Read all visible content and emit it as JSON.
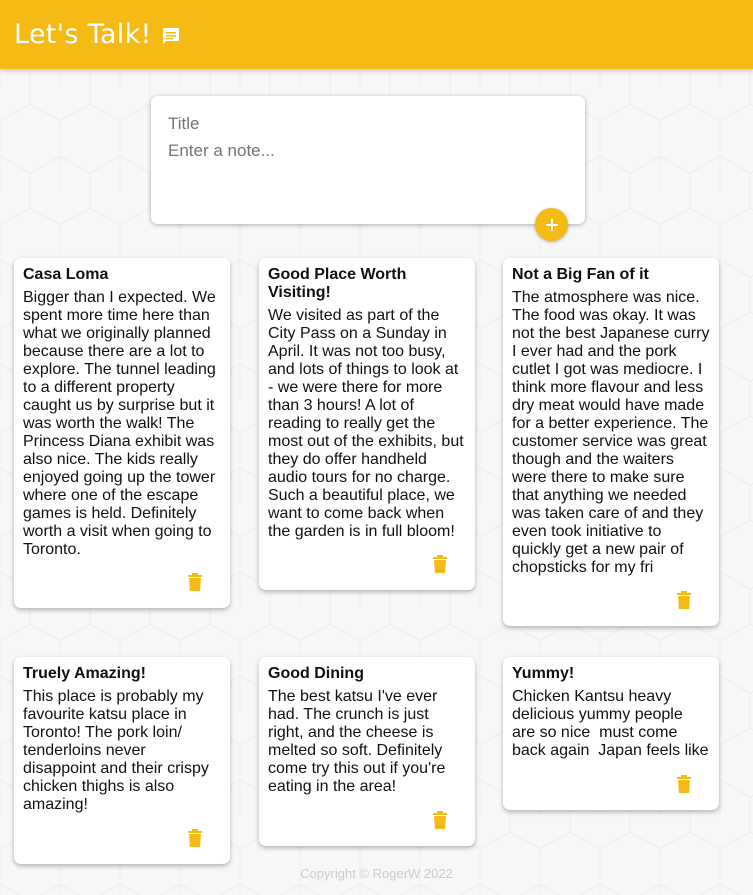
{
  "header": {
    "title": "Let's Talk!"
  },
  "create": {
    "title_placeholder": "Title",
    "content_placeholder": "Enter a note...",
    "add_label": "+"
  },
  "notes": [
    {
      "title": "Casa Loma",
      "content": "Bigger than I expected. We spent more time here than what we originally planned because there are a lot to explore. The tunnel leading to a different property caught us by surprise but it was worth the walk! The Princess Diana exhibit was also nice. The kids really enjoyed going up the tower where one of the escape games is held. Definitely worth a visit when going to Toronto."
    },
    {
      "title": "Good Place Worth Visiting!",
      "content": "We visited as part of the City Pass on a Sunday in April. It was not too busy, and lots of things to look at - we were there for more than 3 hours! A lot of reading to really get the most out of the exhibits, but they do offer handheld audio tours for no charge. Such a beautiful place, we want to come back when the garden is in full bloom!"
    },
    {
      "title": "Not a Big Fan of it",
      "content": "The atmosphere was nice. The food was okay. It was not the best Japanese curry I ever had and the pork cutlet I got was mediocre. I think more flavour and less dry meat would have made for a better experience. The customer service was great though and the waiters were there to make sure that anything we needed was taken care of and they even took initiative to quickly get a new pair of chopsticks for my fri"
    },
    {
      "title": "Truely Amazing!",
      "content": "This place is probably my favourite katsu place in Toronto! The pork loin/ tenderloins never disappoint and their crispy chicken thighs is also amazing!"
    },
    {
      "title": "Good Dining",
      "content": "The best katsu I've ever had. The crunch is just right, and the cheese is melted so soft. Definitely come try this out if you're eating in the area!"
    },
    {
      "title": "Yummy!",
      "content": "Chicken Kantsu heavy delicious yummy people are so nice  must come back again  Japan feels like"
    }
  ],
  "footer": {
    "copyright": "Copyright © RogerW 2022"
  },
  "colors": {
    "accent": "#f5ba13",
    "background": "#f7f7f7",
    "card": "#ffffff"
  },
  "icons": {
    "header": "chat-icon",
    "add": "plus-icon",
    "delete": "trash-icon"
  }
}
